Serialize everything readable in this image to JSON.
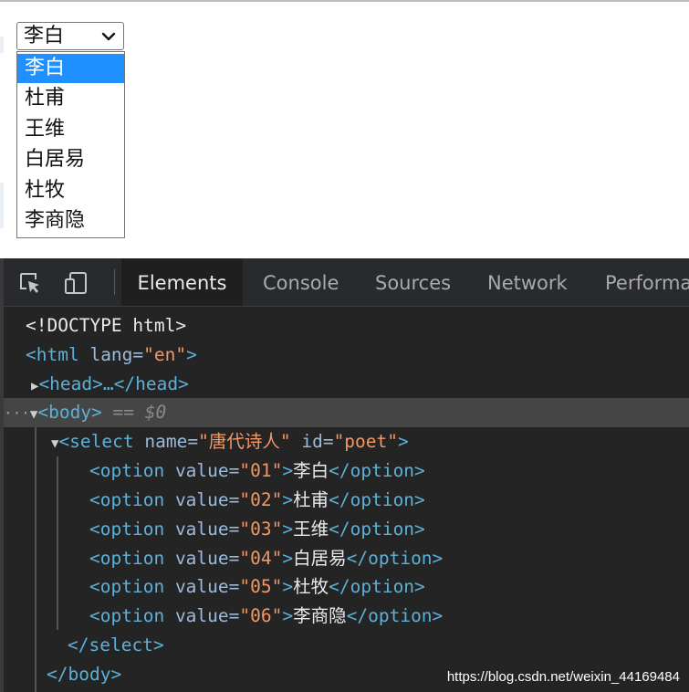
{
  "page": {
    "select": {
      "selected": "李白",
      "options": [
        "李白",
        "杜甫",
        "王维",
        "白居易",
        "杜牧",
        "李商隐"
      ]
    }
  },
  "devtools": {
    "tabs": [
      "Elements",
      "Console",
      "Sources",
      "Network",
      "Performa"
    ],
    "active_tab": "Elements",
    "dom": {
      "doctype": "<!DOCTYPE html>",
      "html_open": "<html",
      "html_attr_name": "lang",
      "html_attr_value": "\"en\"",
      "head": "<head>…</head>",
      "body_open": "<body>",
      "body_selected_marker": "== $0",
      "select_open": "<select",
      "select_name_attr": "name",
      "select_name_value": "\"唐代诗人\"",
      "select_id_attr": "id",
      "select_id_value": "\"poet\"",
      "option_open": "<option",
      "option_attr": "value",
      "option_close": "</option>",
      "options": [
        {
          "value": "\"01\"",
          "text": "李白"
        },
        {
          "value": "\"02\"",
          "text": "杜甫"
        },
        {
          "value": "\"03\"",
          "text": "王维"
        },
        {
          "value": "\"04\"",
          "text": "白居易"
        },
        {
          "value": "\"05\"",
          "text": "杜牧"
        },
        {
          "value": "\"06\"",
          "text": "李商隐"
        }
      ],
      "select_close": "</select>",
      "body_close": "</body>"
    },
    "watermark": "https://blog.csdn.net/weixin_44169484"
  },
  "icons": {
    "inspect": "inspect-element-icon",
    "device": "device-toggle-icon",
    "dropdown_chevron": "chevron-down-icon"
  },
  "colors": {
    "option_highlight": "#1e90ff",
    "devtools_bg": "#242424",
    "tag": "#5db0d7",
    "attr_name": "#9bbbdc",
    "attr_value": "#f29766"
  }
}
